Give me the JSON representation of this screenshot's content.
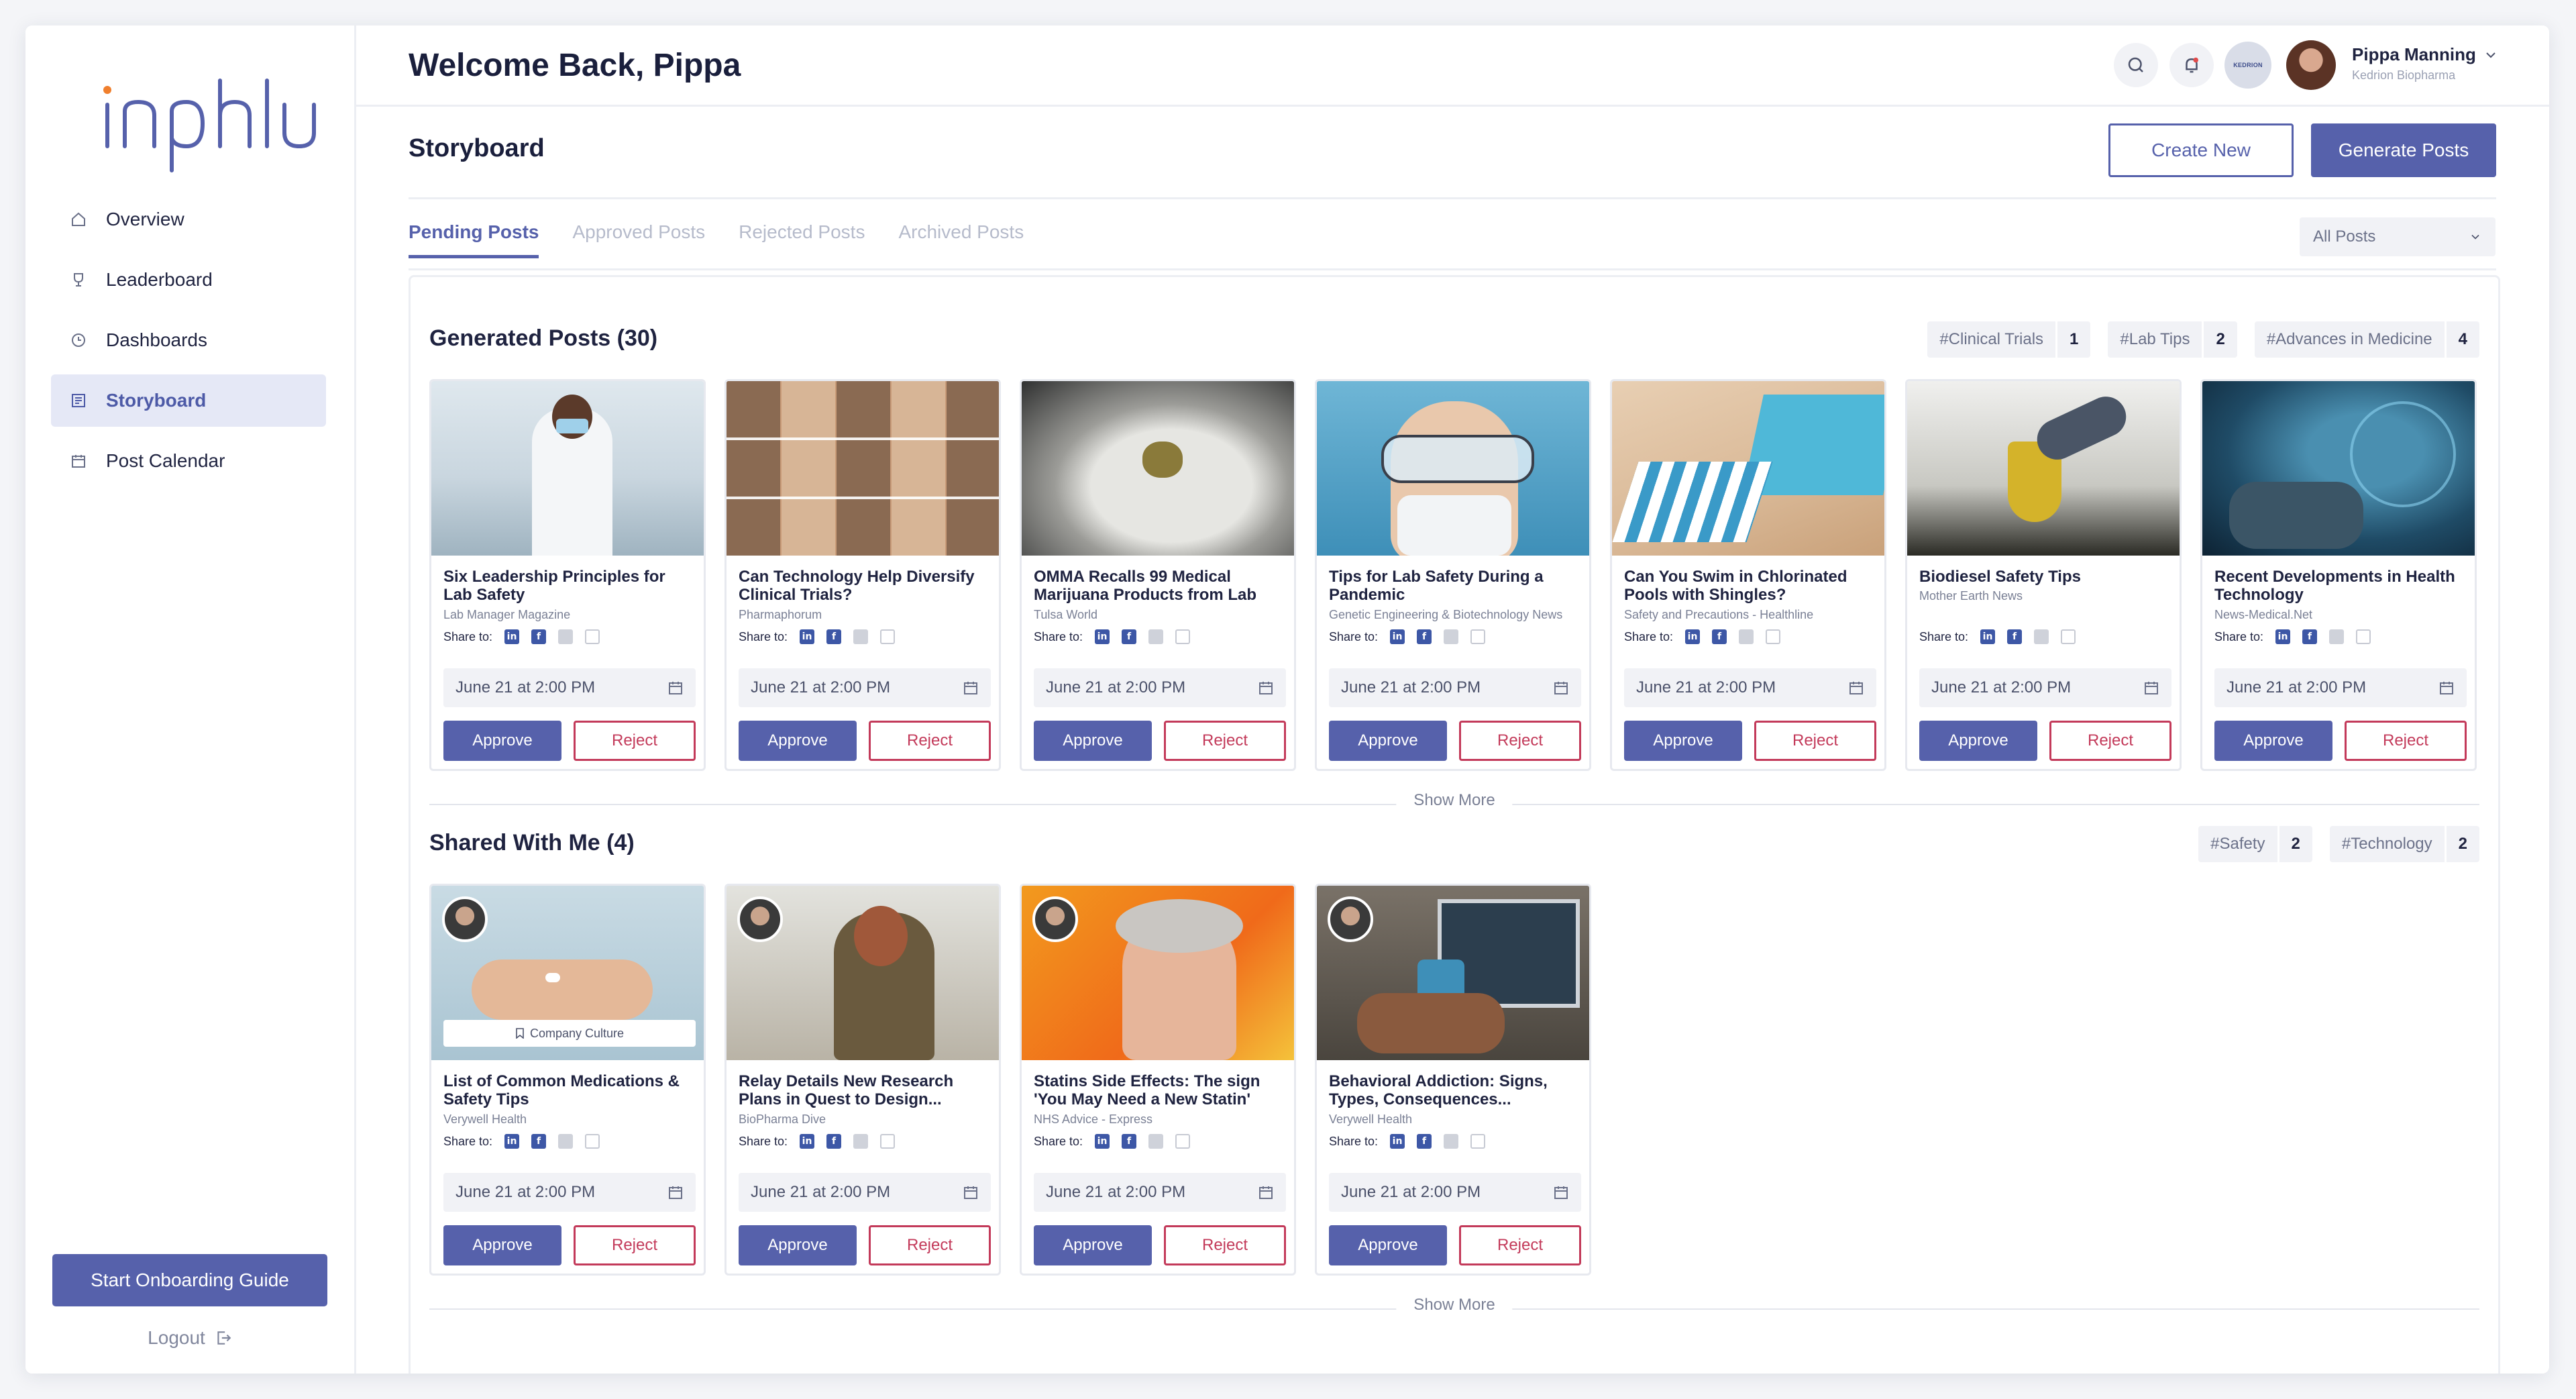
{
  "brand": {
    "logo_text": "inphu",
    "accent": "#5661ab",
    "danger": "#c33a5a",
    "logo_dot": "#f07f2d"
  },
  "sidebar": {
    "items": [
      {
        "label": "Overview",
        "icon": "home-icon"
      },
      {
        "label": "Leaderboard",
        "icon": "trophy-icon"
      },
      {
        "label": "Dashboards",
        "icon": "clock-icon"
      },
      {
        "label": "Storyboard",
        "icon": "storyboard-icon",
        "active": true
      },
      {
        "label": "Post Calendar",
        "icon": "calendar-icon"
      }
    ],
    "onboarding_label": "Start Onboarding Guide",
    "logout_label": "Logout"
  },
  "header": {
    "welcome": "Welcome Back, Pippa",
    "org_logo_text": "KEDRION",
    "user_name": "Pippa Manning",
    "user_org": "Kedrion Biopharma"
  },
  "storyboard": {
    "title": "Storyboard",
    "create_label": "Create New",
    "generate_label": "Generate Posts",
    "tabs": [
      "Pending Posts",
      "Approved Posts",
      "Rejected Posts",
      "Archived Posts"
    ],
    "filter_value": "All Posts"
  },
  "generated": {
    "title": "Generated Posts (30)",
    "tags": [
      {
        "label": "#Clinical Trials",
        "count": "1"
      },
      {
        "label": "#Lab Tips",
        "count": "2"
      },
      {
        "label": "#Advances in Medicine",
        "count": "4"
      }
    ],
    "cards": [
      {
        "title": "Six Leadership Principles for Lab Safety",
        "source": "Lab Manager Magazine",
        "date": "June 21 at 2:00 PM"
      },
      {
        "title": "Can Technology Help Diversify Clinical Trials?",
        "source": "Pharmaphorum",
        "date": "June 21 at 2:00 PM"
      },
      {
        "title": "OMMA Recalls 99 Medical Marijuana Products from Lab",
        "source": "Tulsa World",
        "date": "June 21 at 2:00 PM"
      },
      {
        "title": "Tips for Lab Safety During a Pandemic",
        "source": "Genetic Engineering & Biotechnology News",
        "date": "June 21 at 2:00 PM"
      },
      {
        "title": "Can You Swim in Chlorinated Pools with Shingles?",
        "source": "Safety and Precautions - Healthline",
        "date": "June 21 at 2:00 PM"
      },
      {
        "title": "Biodiesel Safety Tips",
        "source": "Mother Earth News",
        "date": "June 21 at 2:00 PM"
      },
      {
        "title": "Recent Developments in Health Technology",
        "source": "News-Medical.Net",
        "date": "June 21 at 2:00 PM"
      }
    ],
    "show_more": "Show More"
  },
  "shared": {
    "title": "Shared With Me (4)",
    "tags": [
      {
        "label": "#Safety",
        "count": "2"
      },
      {
        "label": "#Technology",
        "count": "2"
      }
    ],
    "cards": [
      {
        "title": "List of Common Medications & Safety Tips",
        "source": "Verywell Health",
        "date": "June 21 at 2:00 PM",
        "badge": "Company Culture"
      },
      {
        "title": "Relay Details New Research Plans in Quest to Design...",
        "source": "BioPharma Dive",
        "date": "June 21 at 2:00 PM"
      },
      {
        "title": "Statins Side Effects: The sign 'You May Need a New Statin'",
        "source": "NHS Advice - Express",
        "date": "June 21 at 2:00 PM"
      },
      {
        "title": "Behavioral Addiction: Signs, Types, Consequences...",
        "source": "Verywell Health",
        "date": "June 21 at 2:00 PM"
      }
    ],
    "show_more": "Show More"
  },
  "card_labels": {
    "share_to": "Share to:",
    "approve": "Approve",
    "reject": "Reject"
  }
}
